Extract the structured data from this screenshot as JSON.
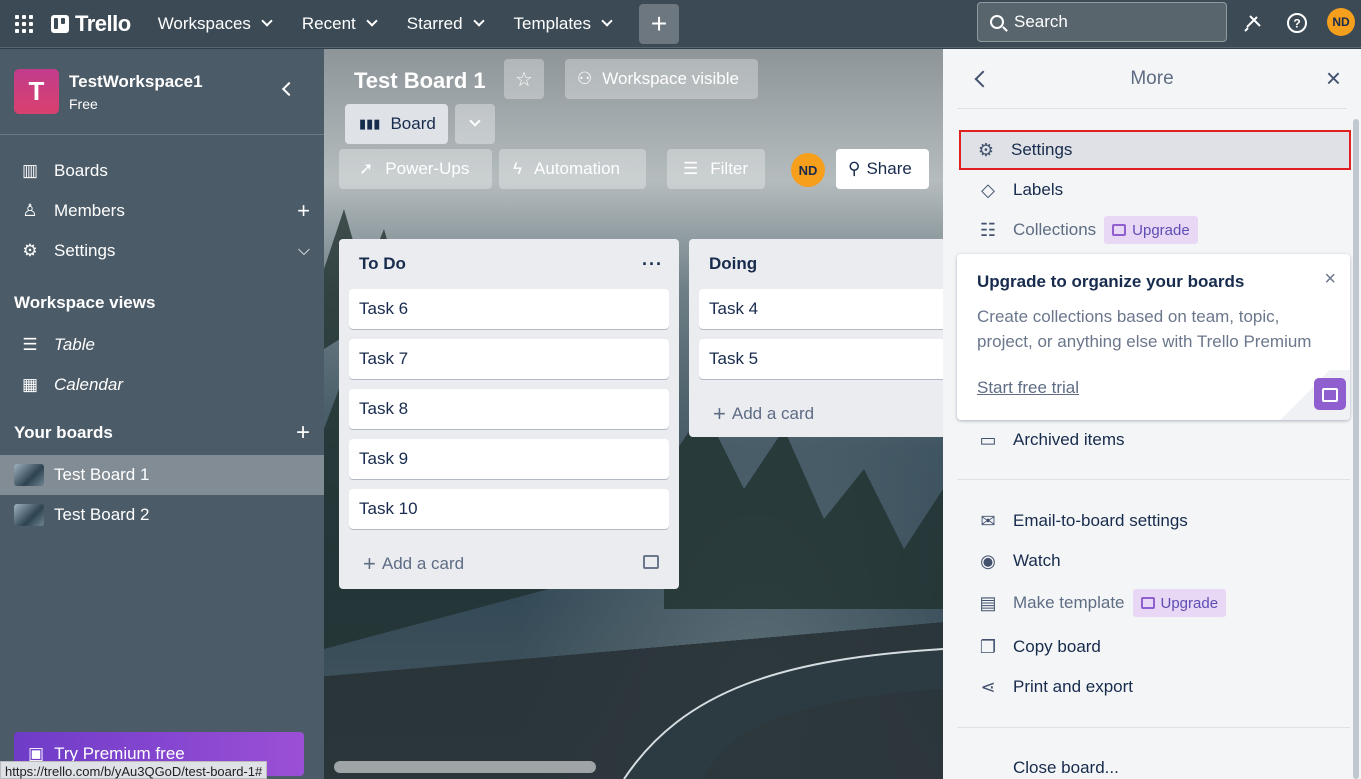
{
  "topbar": {
    "logo": "Trello",
    "menu": [
      {
        "label": "Workspaces"
      },
      {
        "label": "Recent"
      },
      {
        "label": "Starred"
      },
      {
        "label": "Templates"
      }
    ],
    "search_label": "Search",
    "avatar_initials": "ND"
  },
  "sidebar": {
    "workspace_initial": "T",
    "workspace_name": "TestWorkspace1",
    "workspace_plan": "Free",
    "items": [
      {
        "label": "Boards"
      },
      {
        "label": "Members"
      },
      {
        "label": "Settings"
      }
    ],
    "views_heading": "Workspace views",
    "views": [
      {
        "label": "Table"
      },
      {
        "label": "Calendar"
      }
    ],
    "boards_heading": "Your boards",
    "boards": [
      {
        "label": "Test Board 1"
      },
      {
        "label": "Test Board 2"
      }
    ],
    "premium_label": "Try Premium free",
    "status_url": "https://trello.com/b/yAu3QGoD/test-board-1#"
  },
  "board": {
    "title": "Test Board 1",
    "visibility": "Workspace visible",
    "view_label": "Board",
    "tools": {
      "power_ups": "Power-Ups",
      "automation": "Automation",
      "filter": "Filter"
    },
    "member_initials": "ND",
    "share_label": "Share",
    "lists": [
      {
        "name": "To Do",
        "cards": [
          "Task 6",
          "Task 7",
          "Task 8",
          "Task 9",
          "Task 10"
        ],
        "add_label": "Add a card"
      },
      {
        "name": "Doing",
        "cards": [
          "Task 4",
          "Task 5"
        ],
        "add_label": "Add a card"
      }
    ]
  },
  "panel": {
    "title": "More",
    "items": {
      "settings": "Settings",
      "labels": "Labels",
      "collections": "Collections",
      "archived": "Archived items",
      "email": "Email-to-board settings",
      "watch": "Watch",
      "make_template": "Make template",
      "copy": "Copy board",
      "print": "Print and export",
      "close": "Close board..."
    },
    "upgrade_label": "Upgrade",
    "promo": {
      "title": "Upgrade to organize your boards",
      "body": "Create collections based on team, topic, project, or anything else with Trello Premium",
      "cta": "Start free trial"
    }
  },
  "colors": {
    "accent_avatar": "#f59f1c",
    "highlight_border": "#e02020",
    "upgrade_purple": "#8f5fd0"
  }
}
